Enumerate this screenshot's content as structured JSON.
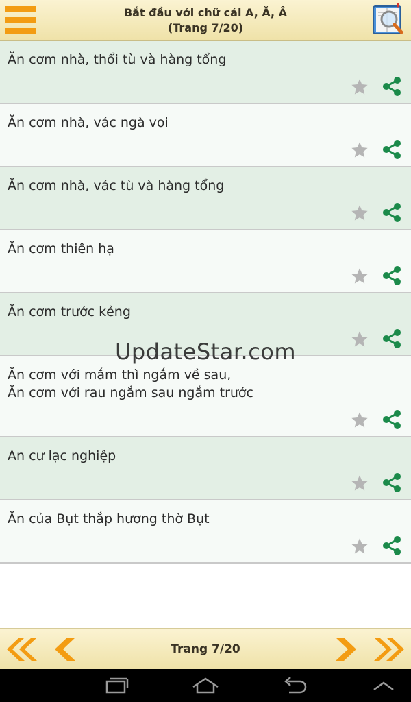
{
  "header": {
    "title_line1": "Bắt đầu với chữ cái A, Ă, Â",
    "title_line2": "(Trang 7/20)",
    "menu_icon": "hamburger-menu-icon",
    "search_icon": "book-search-icon"
  },
  "items": [
    {
      "text": "Ăn cơm nhà, thổi tù và hàng tổng"
    },
    {
      "text": "Ăn cơm nhà, vác ngà voi"
    },
    {
      "text": "Ăn cơm nhà, vác tù và hàng tổng"
    },
    {
      "text": "Ăn cơm thiên hạ"
    },
    {
      "text": "Ăn cơm trước kẻng"
    },
    {
      "text": "Ăn cơm với mắm thì ngắm về sau,\nĂn cơm với rau ngắm sau ngắm trước"
    },
    {
      "text": "An cư lạc nghiệp"
    },
    {
      "text": "Ăn của Bụt thắp hương thờ Bụt"
    }
  ],
  "watermark": "UpdateStar.com",
  "footer": {
    "page_label": "Trang 7/20"
  },
  "colors": {
    "accent_orange": "#f39c12",
    "share_green": "#1b8a4a",
    "star_gray": "#b5b5b5",
    "row_odd": "#e3efe5",
    "row_even": "#f6faf7"
  }
}
